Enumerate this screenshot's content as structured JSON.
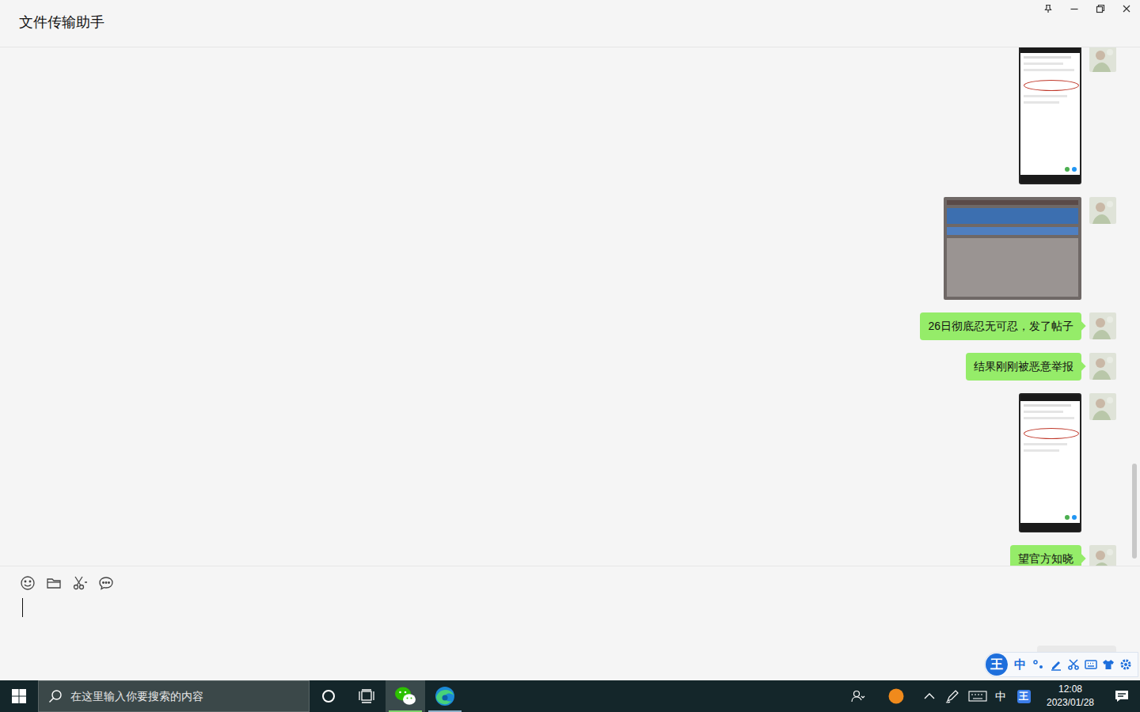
{
  "window": {
    "title": "文件传输助手"
  },
  "messages": [
    {
      "kind": "screenshot"
    },
    {
      "kind": "photo"
    },
    {
      "kind": "text",
      "text": "26日彻底忍无可忍，发了帖子"
    },
    {
      "kind": "text",
      "text": "结果刚刚被恶意举报"
    },
    {
      "kind": "screenshot"
    },
    {
      "kind": "text",
      "text": "望官方知晓"
    }
  ],
  "scroll": {
    "level": 0.99
  },
  "ime": {
    "logo": "王",
    "mode": "中"
  },
  "taskbar": {
    "search": {
      "placeholder": "在这里输入你要搜索的内容"
    },
    "apps": [
      {
        "kind": "wechat",
        "selected": true
      },
      {
        "kind": "edge",
        "selected": false
      }
    ],
    "language": "中",
    "ime_logo": "王",
    "time": "12:08",
    "date": "2023/01/28"
  }
}
